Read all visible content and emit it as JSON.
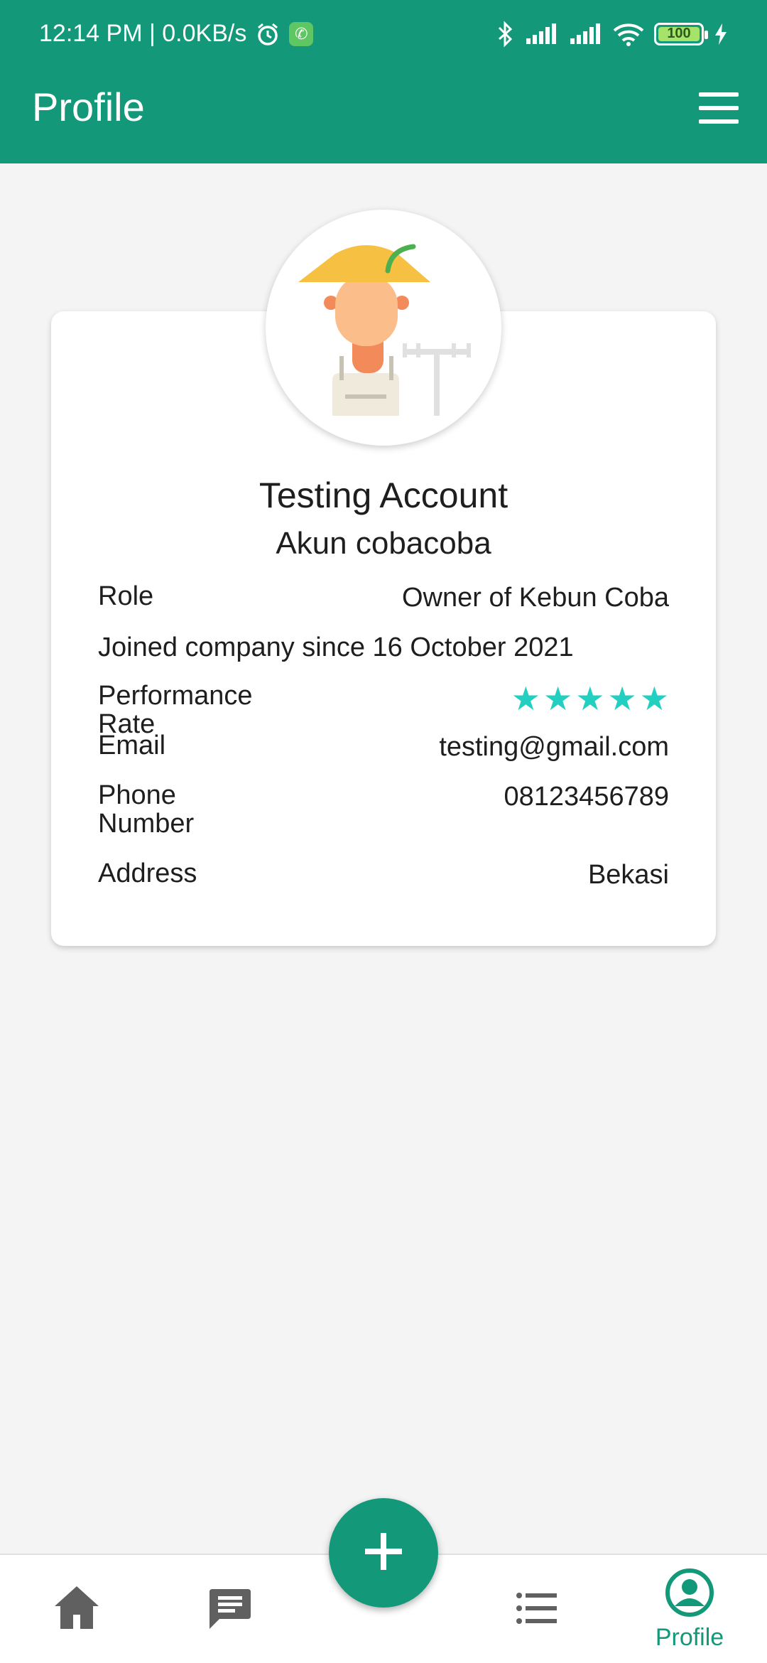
{
  "status_bar": {
    "time_speed": "12:14 PM | 0.0KB/s",
    "battery": "100",
    "icons": [
      "alarm-icon",
      "whatsapp-icon",
      "bluetooth-icon",
      "signal-icon",
      "signal-icon",
      "wifi-icon",
      "battery-icon",
      "charging-icon"
    ]
  },
  "app_bar": {
    "title": "Profile",
    "menu_icon": "hamburger-menu-icon"
  },
  "profile": {
    "avatar_icon": "farmer-avatar-icon",
    "name": "Testing Account",
    "username": "Akun cobacoba",
    "role_label": "Role",
    "role_value": "Owner of Kebun Coba",
    "joined_text": "Joined company since 16 October 2021",
    "performance_label": "Performance Rate",
    "performance_rating": 5,
    "performance_max": 5,
    "email_label": "Email",
    "email_value": "testing@gmail.com",
    "phone_label": "Phone Number",
    "phone_value": "08123456789",
    "address_label": "Address",
    "address_value": "Bekasi"
  },
  "bottom_nav": {
    "items": [
      {
        "icon": "home-icon"
      },
      {
        "icon": "chat-icon"
      },
      {
        "icon": "list-icon"
      },
      {
        "icon": "profile-icon",
        "label": "Profile",
        "active": true
      }
    ],
    "fab_icon": "plus-icon"
  },
  "colors": {
    "primary": "#14987a",
    "star": "#22cfc0",
    "inactive_icon": "#606060",
    "background": "#f4f4f4"
  }
}
